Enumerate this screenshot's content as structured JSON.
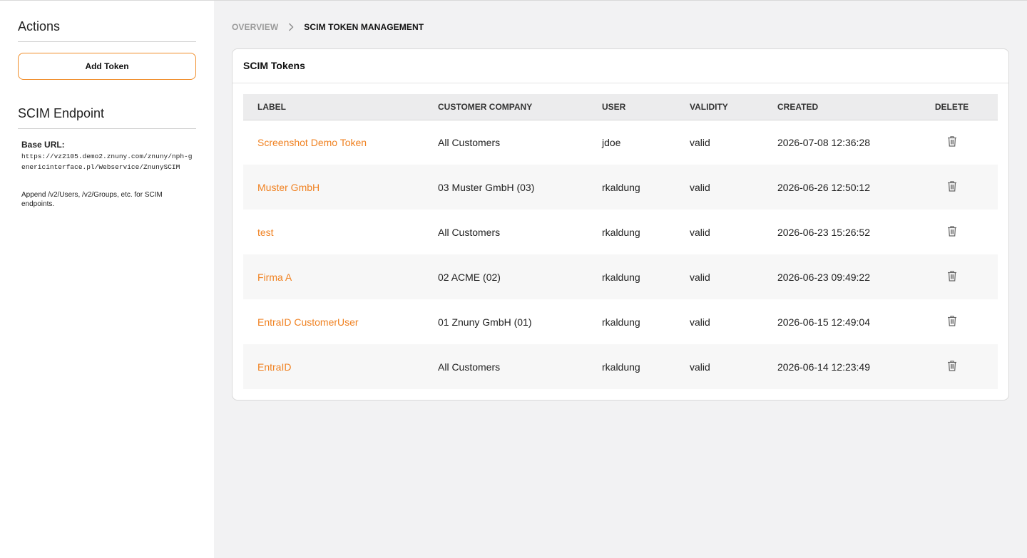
{
  "sidebar": {
    "actions_heading": "Actions",
    "add_token_label": "Add Token",
    "endpoint_heading": "SCIM Endpoint",
    "base_url_label": "Base URL:",
    "base_url": "https://vz2105.demo2.znuny.com/znuny/nph-genericinterface.pl/Webservice/ZnunySCIM",
    "append_note": "Append /v2/Users, /v2/Groups, etc. for SCIM endpoints."
  },
  "breadcrumb": {
    "overview": "OVERVIEW",
    "current": "SCIM TOKEN MANAGEMENT"
  },
  "card": {
    "title": "SCIM Tokens"
  },
  "table": {
    "headers": {
      "label": "LABEL",
      "company": "CUSTOMER COMPANY",
      "user": "USER",
      "validity": "VALIDITY",
      "created": "CREATED",
      "delete": "DELETE"
    },
    "rows": [
      {
        "label": "Screenshot Demo Token",
        "company": "All Customers",
        "user": "jdoe",
        "validity": "valid",
        "created": "2026-07-08 12:36:28"
      },
      {
        "label": "Muster GmbH",
        "company": "03 Muster GmbH (03)",
        "user": "rkaldung",
        "validity": "valid",
        "created": "2026-06-26 12:50:12"
      },
      {
        "label": "test",
        "company": "All Customers",
        "user": "rkaldung",
        "validity": "valid",
        "created": "2026-06-23 15:26:52"
      },
      {
        "label": "Firma A",
        "company": "02 ACME (02)",
        "user": "rkaldung",
        "validity": "valid",
        "created": "2026-06-23 09:49:22"
      },
      {
        "label": "EntraID CustomerUser",
        "company": "01 Znuny GmbH (01)",
        "user": "rkaldung",
        "validity": "valid",
        "created": "2026-06-15 12:49:04"
      },
      {
        "label": "EntraID",
        "company": "All Customers",
        "user": "rkaldung",
        "validity": "valid",
        "created": "2026-06-14 12:23:49"
      }
    ]
  },
  "colors": {
    "accent": "#f08222",
    "link": "#f08222"
  },
  "icons": {
    "breadcrumb_separator": "chevron-right-icon",
    "delete": "trash-icon"
  }
}
